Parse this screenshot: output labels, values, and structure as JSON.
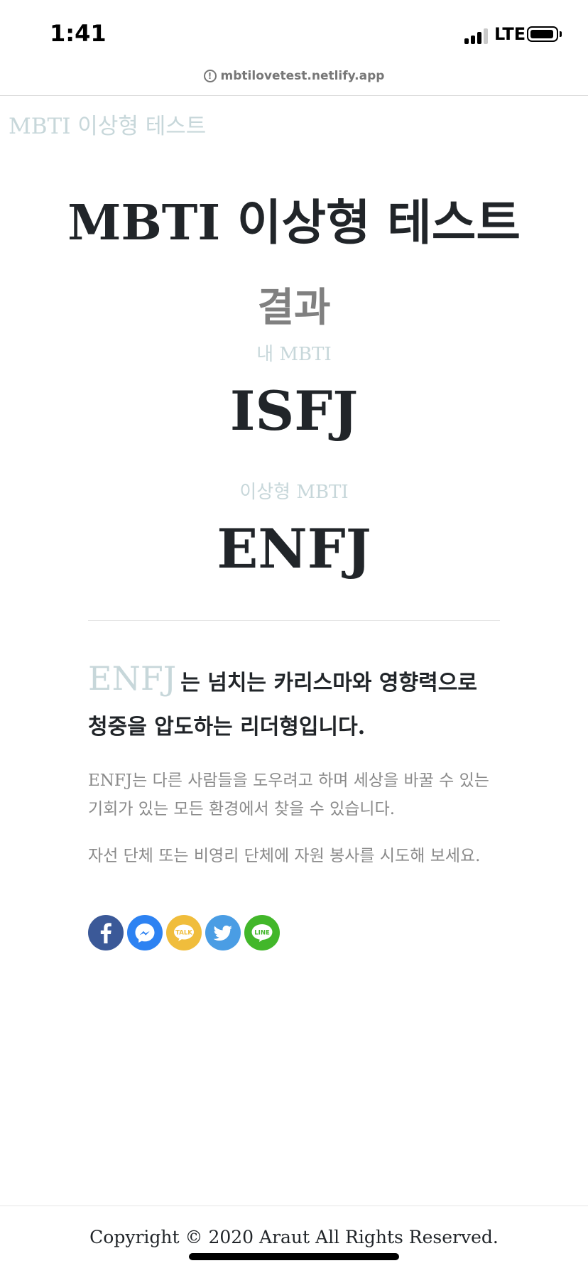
{
  "status_bar": {
    "time": "1:41",
    "network": "LTE"
  },
  "browser": {
    "url": "mbtilovetest.netlify.app"
  },
  "brand": "MBTI 이상형 테스트",
  "title": "MBTI 이상형 테스트",
  "result": {
    "heading": "결과",
    "my_label": "내 MBTI",
    "my_type": "ISFJ",
    "ideal_label": "이상형 MBTI",
    "ideal_type": "ENFJ"
  },
  "description": {
    "type": "ENFJ",
    "headline": "는 넘치는 카리스마와 영향력으로 청중을 압도하는 리더형입니다.",
    "paragraph1": "ENFJ는 다른 사람들을 도우려고 하며 세상을 바꿀 수 있는 기회가 있는 모든 환경에서 찾을 수 있습니다.",
    "paragraph2": "자선 단체 또는 비영리 단체에 자원 봉사를 시도해 보세요."
  },
  "share": [
    {
      "name": "facebook-icon",
      "color": "#3b5998"
    },
    {
      "name": "messenger-icon",
      "color": "#2d82f2"
    },
    {
      "name": "kakaotalk-icon",
      "color": "#f0bd3c",
      "text": "TALK"
    },
    {
      "name": "twitter-icon",
      "color": "#4a9de4"
    },
    {
      "name": "line-icon",
      "color": "#42b72a",
      "text": "LINE"
    }
  ],
  "footer": {
    "copyright": "Copyright © 2020 Araut All Rights Reserved."
  }
}
